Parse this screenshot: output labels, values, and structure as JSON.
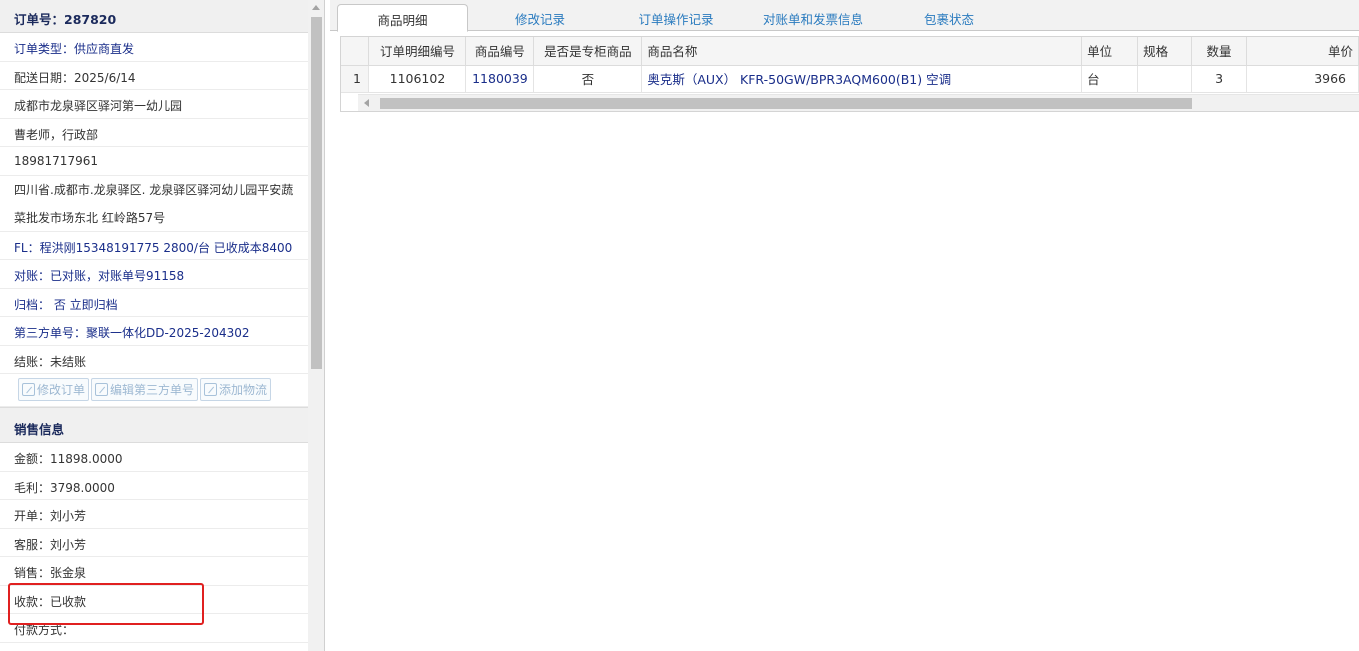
{
  "order_panel": {
    "order_no": "订单号：287820",
    "order_type": "订单类型：供应商直发",
    "delivery_date": "配送日期：2025/6/14",
    "address_short": "成都市龙泉驿区驿河第一幼儿园",
    "contact": "曹老师，行政部",
    "phone": "18981717961",
    "address_full": "四川省.成都市.龙泉驿区. 龙泉驿区驿河幼儿园平安蔬菜批发市场东北 红岭路57号",
    "fl_note": "FL：程洪刚15348191775 2800/台 已收成本8400",
    "reconcile": "对账：已对账，对账单号91158",
    "archive": "归档：  否 立即归档",
    "third_party_no": "第三方单号：聚联一体化DD-2025-204302",
    "settlement": "结账：未结账",
    "buttons": {
      "edit_order": "修改订单",
      "edit_third_party": "编辑第三方单号",
      "add_logistics": "添加物流"
    }
  },
  "sales_info": {
    "title": "销售信息",
    "amount": "金额：11898.0000",
    "gross_profit": "毛利：3798.0000",
    "issuer": "开单：刘小芳",
    "customer_service": "客服：刘小芳",
    "sales": "销售：张金泉",
    "payment_received": "收款：已收款",
    "payment_method": "付款方式："
  },
  "tabs": [
    "商品明细",
    "修改记录",
    "订单操作记录",
    "对账单和发票信息",
    "包裹状态"
  ],
  "active_tab": "商品明细",
  "grid": {
    "columns": [
      "订单明细编号",
      "商品编号",
      "是否是专柜商品",
      "商品名称",
      "单位",
      "规格",
      "数量",
      "单价"
    ],
    "rows": [
      {
        "row_no": "1",
        "detail_no": "1106102",
        "product_no": "1180039",
        "is_counter": "否",
        "product_name": "奥克斯（AUX） KFR-50GW/BPR3AQM600(B1) 空调",
        "unit": "台",
        "spec": "",
        "quantity": "3",
        "unit_price": "3966"
      }
    ]
  },
  "colors": {
    "highlight_border": "#e02020",
    "link_blue": "#1a2e8a",
    "tab_blue": "#2a7bbf"
  }
}
